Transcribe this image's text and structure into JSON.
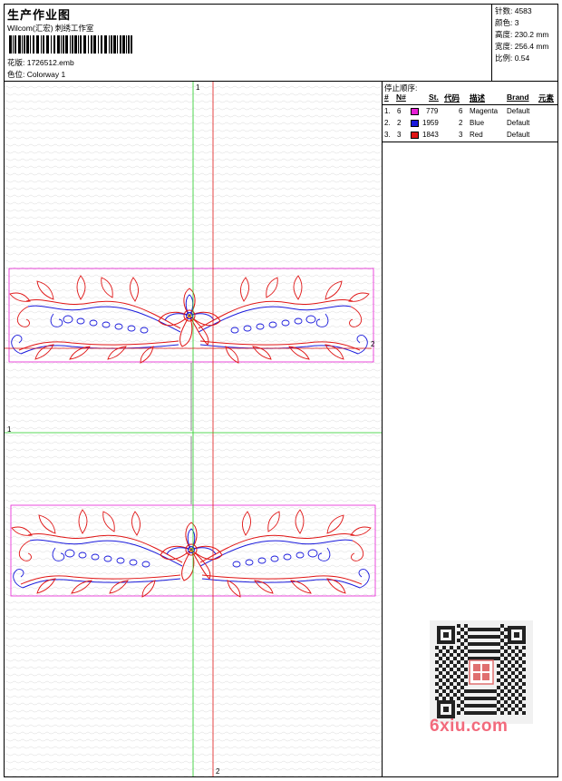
{
  "header": {
    "title": "生产作业图",
    "subtitle": "Wilcom(汇宏) 刺绣工作室",
    "design_file": "花版:  1726512.emb",
    "colorway": "色位:  Colorway 1"
  },
  "stats": {
    "stitches": "针数: 4583",
    "colors": "颜色: 3",
    "height": "高度: 230.2 mm",
    "width": "宽度: 256.4 mm",
    "scale": "比例: 0.54"
  },
  "stop_sequence": {
    "title": "停止顺序:",
    "headers": {
      "num": "#",
      "needle": "N#",
      "stitches": "St.",
      "code": "代码",
      "desc": "描述",
      "brand": "Brand",
      "element": "元素"
    },
    "rows": [
      {
        "num": "1.",
        "needle": "6",
        "stitches": "779",
        "code": "6",
        "desc": "Magenta",
        "brand": "Default",
        "color": "#e61fd4"
      },
      {
        "num": "2.",
        "needle": "2",
        "stitches": "1959",
        "code": "2",
        "desc": "Blue",
        "brand": "Default",
        "color": "#1a1adc"
      },
      {
        "num": "3.",
        "needle": "3",
        "stitches": "1843",
        "code": "3",
        "desc": "Red",
        "brand": "Default",
        "color": "#e01515"
      }
    ]
  },
  "axes": {
    "green_top": "1",
    "green_left": "1",
    "red_right": "2",
    "red_bottom": "2"
  },
  "watermark": "6xiu.com",
  "colors": {
    "magenta": "#e61fd4",
    "blue": "#1a1adc",
    "red": "#e01515",
    "green": "#22cc22"
  }
}
